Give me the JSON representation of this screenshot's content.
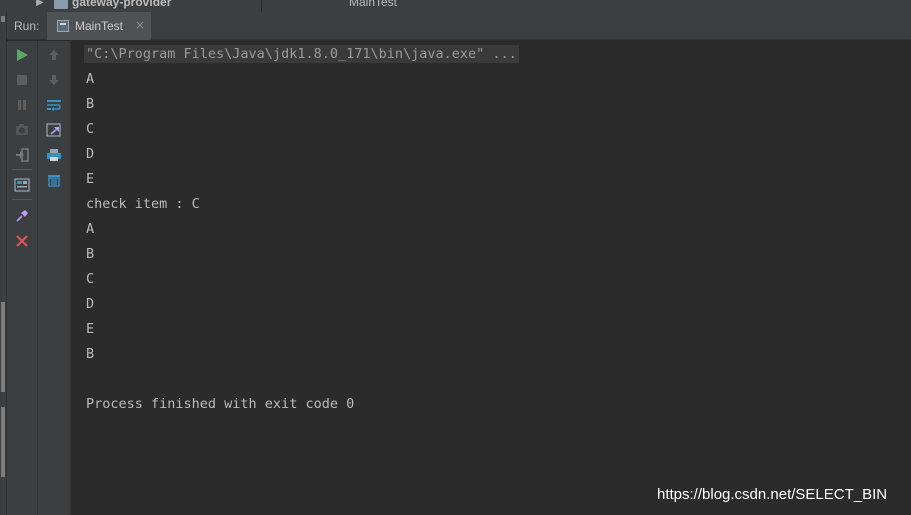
{
  "project_tree": {
    "folder_label": "gateway-provider",
    "editor_tab_label": "MainTest"
  },
  "run_panel": {
    "title": "Run:",
    "tab_label": "MainTest",
    "tab_close": "×"
  },
  "toolbar_left": [
    {
      "name": "rerun-icon",
      "color": "#59a869"
    },
    {
      "name": "stop-icon",
      "color": "#6e6e6e"
    },
    {
      "name": "pause-icon",
      "color": "#6e6e6e"
    },
    {
      "name": "dump-threads-icon",
      "color": "#6e6e6e"
    },
    {
      "name": "exit-icon",
      "color": "#6e6e6e"
    },
    {
      "name": "layout-icon",
      "color": "#9aa7b0"
    },
    {
      "name": "pin-icon",
      "color": "#b99bf8"
    },
    {
      "name": "close-icon",
      "color": "#e05555"
    }
  ],
  "toolbar_right": [
    {
      "name": "scroll-up-icon",
      "color": "#6e6e6e"
    },
    {
      "name": "scroll-down-icon",
      "color": "#6e6e6e"
    },
    {
      "name": "soft-wrap-icon",
      "color": "#3592c4"
    },
    {
      "name": "scroll-to-end-icon",
      "color": "#3592c4"
    },
    {
      "name": "print-icon",
      "color": "#3592c4"
    },
    {
      "name": "clear-all-icon",
      "color": "#3592c4"
    }
  ],
  "console": {
    "command": "\"C:\\Program Files\\Java\\jdk1.8.0_171\\bin\\java.exe\" ...",
    "lines": [
      "A",
      "B",
      "C",
      "D",
      "E",
      "check item : C",
      "A",
      "B",
      "C",
      "D",
      "E",
      "B",
      "",
      "Process finished with exit code 0"
    ]
  },
  "watermark": "https://blog.csdn.net/SELECT_BIN"
}
